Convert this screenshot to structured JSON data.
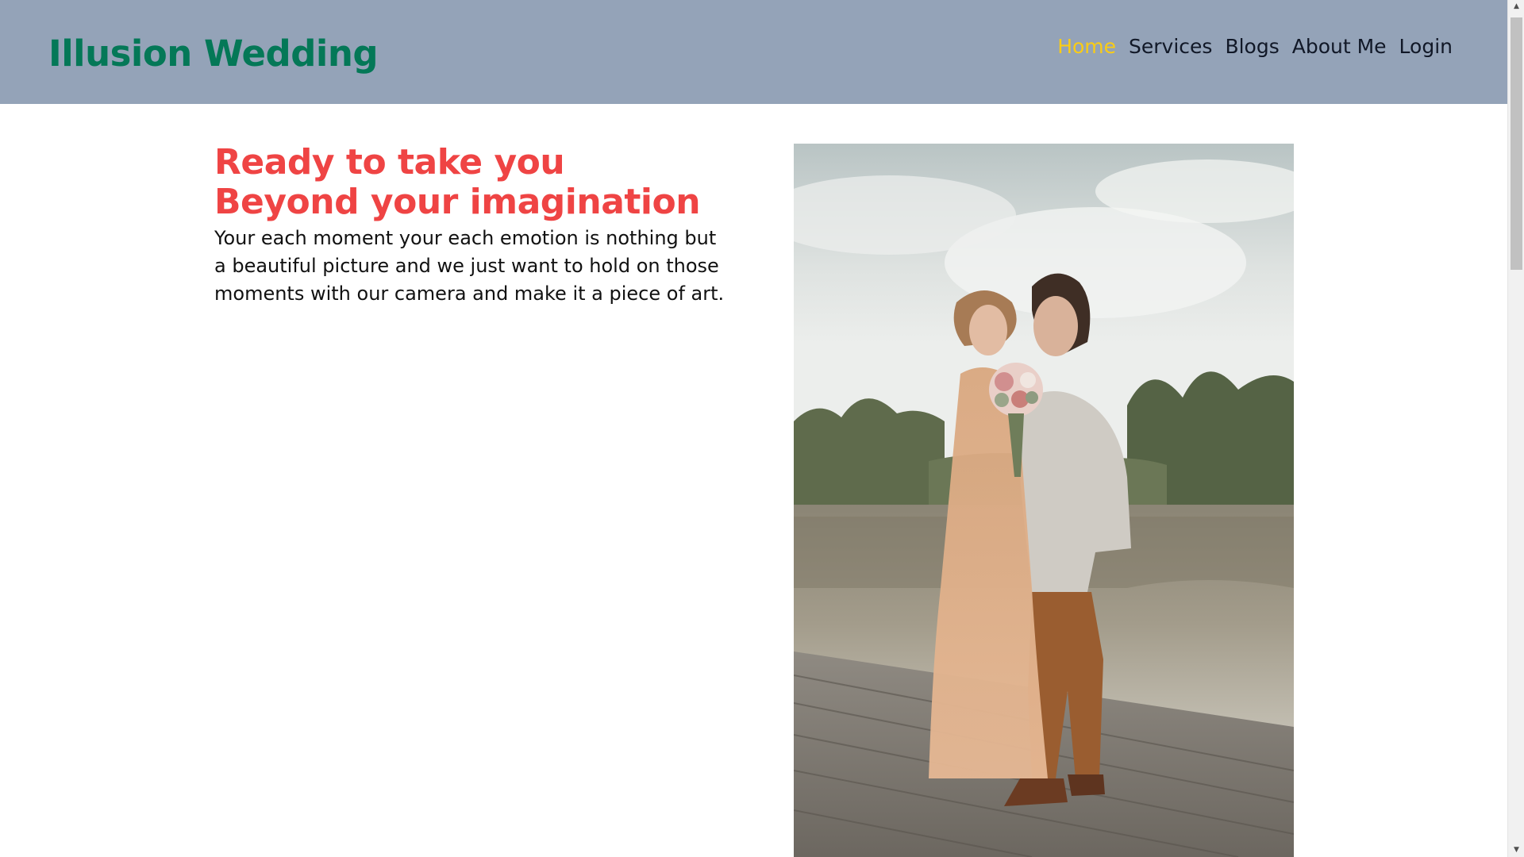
{
  "header": {
    "brand": "Illusion Wedding",
    "nav": [
      {
        "label": "Home",
        "active": true
      },
      {
        "label": "Services",
        "active": false
      },
      {
        "label": "Blogs",
        "active": false
      },
      {
        "label": "About Me",
        "active": false
      },
      {
        "label": "Login",
        "active": false
      }
    ]
  },
  "hero": {
    "title_line1": "Ready to take you",
    "title_line2": "Beyond your imagination",
    "description": "Your each moment your each emotion is nothing but a beautiful picture and we just want to hold on those moments with our camera and make it a piece of art."
  },
  "icons": {
    "scroll_up": "triangle-up-icon",
    "scroll_down": "triangle-down-icon"
  },
  "colors": {
    "header_bg": "#94a3b8",
    "brand": "#047857",
    "nav_active": "#facc15",
    "nav_text": "#111827",
    "headline": "#ef4444"
  },
  "scrollbar": {
    "position_fraction": 0
  }
}
